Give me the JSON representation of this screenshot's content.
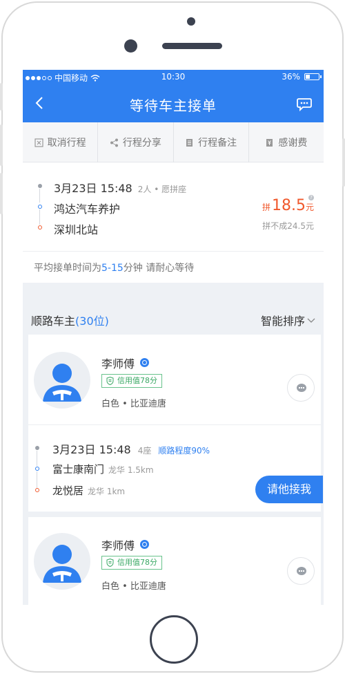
{
  "status_bar": {
    "carrier": "中国移动",
    "time": "10:30",
    "battery": "36%",
    "battery_level": 0.36
  },
  "nav": {
    "title": "等待车主接单"
  },
  "actions": [
    {
      "label": "取消行程",
      "icon": "cancel-icon"
    },
    {
      "label": "行程分享",
      "icon": "share-icon"
    },
    {
      "label": "行程备注",
      "icon": "note-icon"
    },
    {
      "label": "感谢费",
      "icon": "thanks-fee-icon"
    }
  ],
  "trip": {
    "date_time": "3月23日 15:48",
    "passengers": "2人 • 愿拼座",
    "from": "鸿达汽车养护",
    "to": "深圳北站",
    "price_prefix": "拼",
    "price": "18.5",
    "price_unit": "元",
    "no_share_price": "拼不成24.5元",
    "wait_prefix": "平均接单时间为",
    "wait_range": "5-15",
    "wait_suffix": "分钟  请耐心等待"
  },
  "drivers_header": {
    "label": "顺路车主",
    "count": "(30位)",
    "sort_label": "智能排序"
  },
  "drivers": [
    {
      "name": "李师傅",
      "credit": "信用值78分",
      "car": "白色 • 比亚迪唐",
      "date_time": "3月23日 15:48",
      "seats": "4座",
      "match": "顺路程度90%",
      "from": "富士康南门",
      "from_dist": "龙华 1.5km",
      "to": "龙悦居",
      "to_dist": "龙华 1km",
      "button": "请他接我"
    },
    {
      "name": "李师傅",
      "credit": "信用值78分",
      "car": "白色 • 比亚迪唐"
    }
  ],
  "colors": {
    "primary": "#2f80f0",
    "price": "#f0582c",
    "credit": "#3aa864"
  }
}
